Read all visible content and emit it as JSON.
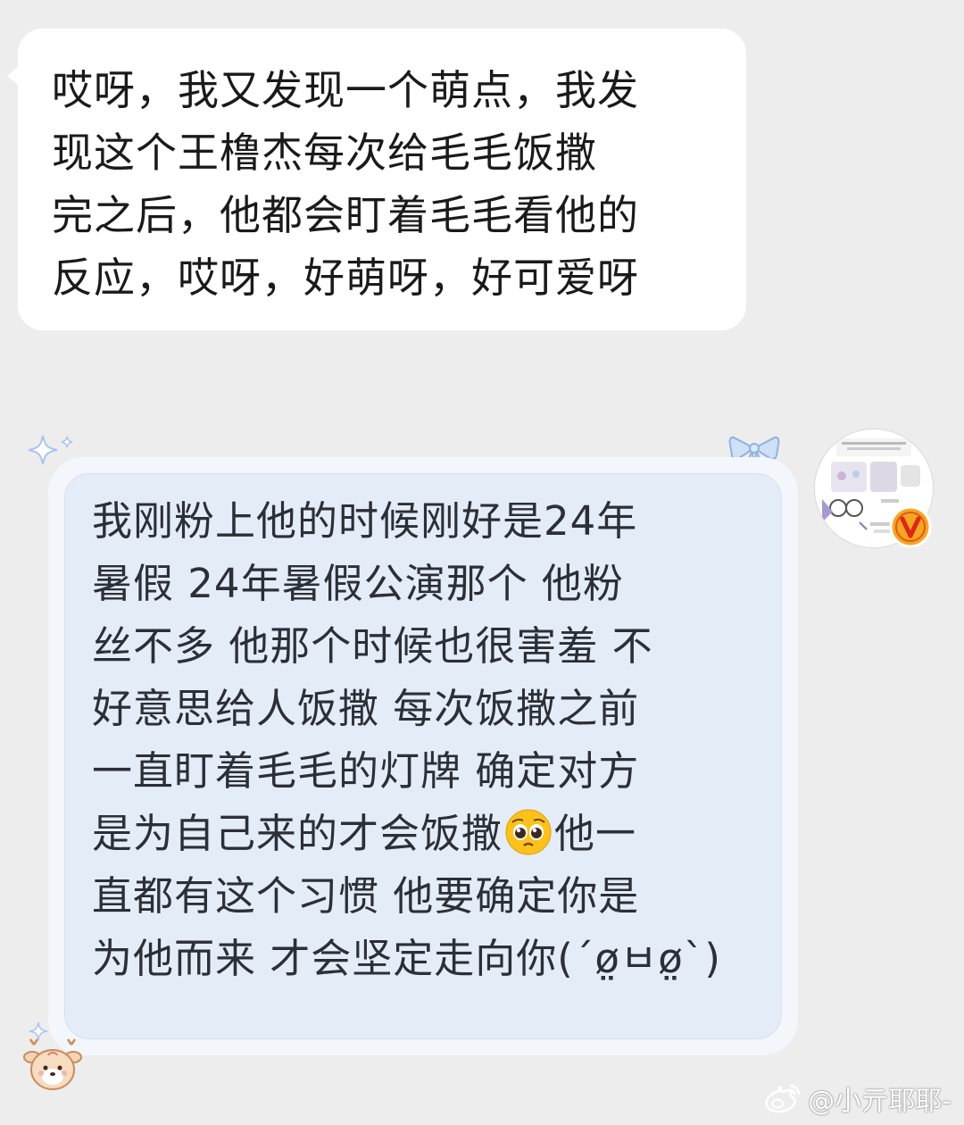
{
  "messages": [
    {
      "side": "left",
      "text": "哎呀，我又发现一个萌点，我发\n现这个王橹杰每次给毛毛饭撒\n完之后，他都会盯着毛毛看他的\n反应，哎呀，好萌呀，好可爱呀"
    },
    {
      "side": "right",
      "text_before_emoji": "我刚粉上他的时候刚好是24年\n暑假 24年暑假公演那个 他粉\n丝不多 他那个时候也很害羞 不\n好意思给人饭撒 每次饭撒之前\n一直盯着毛毛的灯牌 确定对方\n是为自己来的才会饭撒",
      "emoji": "pleading-face-emoji",
      "text_after_emoji": "他一\n直都有这个习惯 他要确定你是\n为他而来 才会坚定走向你(´ø̤ㅂø̤`)"
    }
  ],
  "avatar": {
    "badge_icon": "verified-v-badge-icon",
    "badge_color": "#f5a623"
  },
  "watermark": {
    "icon": "weibo-icon",
    "text": "@小亓耶耶-"
  },
  "colors": {
    "background": "#ededed",
    "left_bubble": "#ffffff",
    "right_bubble": "#e4ecf8",
    "right_bubble_frame": "#f3f6fb"
  }
}
